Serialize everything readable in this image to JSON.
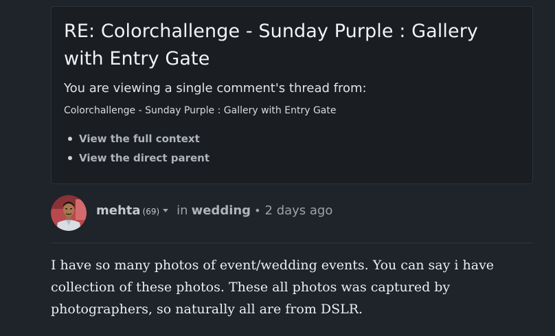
{
  "thread": {
    "title": "RE: Colorchallenge - Sunday Purple : Gallery with Entry Gate",
    "intro": "You are viewing a single comment's thread from:",
    "origin_post": "Colorchallenge - Sunday Purple : Gallery with Entry Gate",
    "links": [
      {
        "label": "View the full context"
      },
      {
        "label": "View the direct parent"
      }
    ]
  },
  "comment": {
    "author": "mehta",
    "reputation": "(69)",
    "in_label": "in",
    "community": "wedding",
    "separator": "•",
    "time": "2 days ago",
    "body": "I have so many photos of event/wedding events. You can say i have collection of these photos. These all photos was captured by photographers, so naturally all are from DSLR."
  },
  "colors": {
    "background": "#1f232a",
    "panel": "#1a1d22",
    "link": "#aeb4bb"
  }
}
